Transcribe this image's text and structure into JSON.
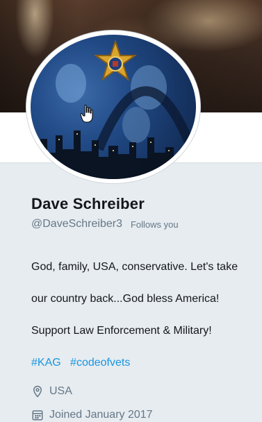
{
  "profile": {
    "display_name": "Dave Schreiber",
    "handle": "@DaveSchreiber3",
    "follows_you_label": "Follows you",
    "bio_lines": [
      "God, family, USA, conservative. Let's take",
      "our country back...God bless America!",
      "Support Law Enforcement & Military!"
    ],
    "hashtags": [
      "#KAG",
      "#codeofvets"
    ],
    "location": "USA",
    "joined": "Joined January 2017"
  },
  "icons": {
    "location": "location-pin-icon",
    "calendar": "calendar-icon",
    "cursor": "hand-pointer-cursor-icon"
  },
  "colors": {
    "name_text": "#14171a",
    "secondary_text": "#657786",
    "link": "#1b95e0",
    "page_background": "#e6ecf0"
  }
}
